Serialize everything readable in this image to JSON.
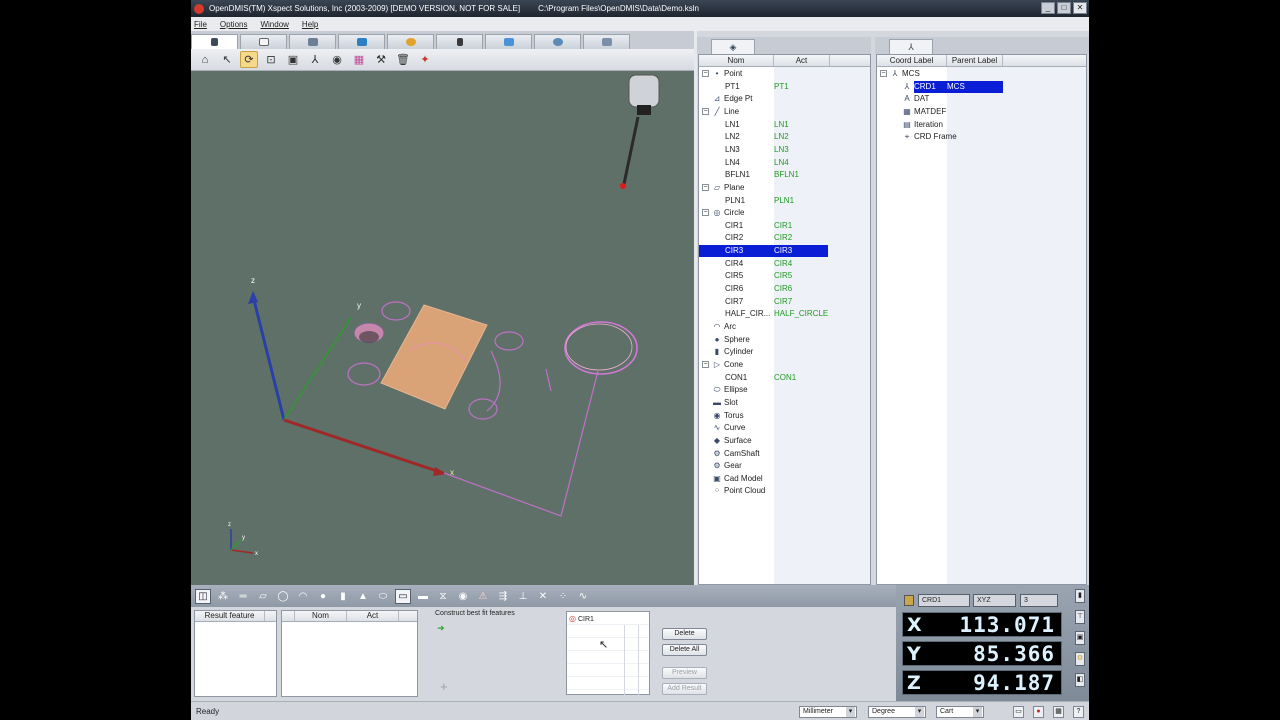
{
  "window": {
    "title": "OpenDMIS(TM) Xspect Solutions, Inc (2003-2009) [DEMO VERSION, NOT FOR SALE]",
    "path": "C:\\Program Files\\OpenDMIS\\Data\\Demo.ksln",
    "minimize": "_",
    "restore": "□",
    "close": "✕"
  },
  "menu": [
    "File",
    "Options",
    "Window",
    "Help"
  ],
  "feature_tree": {
    "headers": [
      "Nom",
      "Act"
    ],
    "rows": [
      {
        "nom": "Point",
        "act": "",
        "type": "group",
        "icon": "point-icon",
        "glyph": "•"
      },
      {
        "nom": "PT1",
        "act": "PT1",
        "type": "item"
      },
      {
        "nom": "Edge Pt",
        "act": "",
        "type": "leaf",
        "icon": "edge-point-icon",
        "glyph": "⊿"
      },
      {
        "nom": "Line",
        "act": "",
        "type": "group",
        "icon": "line-icon",
        "glyph": "╱"
      },
      {
        "nom": "LN1",
        "act": "LN1",
        "type": "item"
      },
      {
        "nom": "LN2",
        "act": "LN2",
        "type": "item"
      },
      {
        "nom": "LN3",
        "act": "LN3",
        "type": "item"
      },
      {
        "nom": "LN4",
        "act": "LN4",
        "type": "item"
      },
      {
        "nom": "BFLN1",
        "act": "BFLN1",
        "type": "item"
      },
      {
        "nom": "Plane",
        "act": "",
        "type": "group",
        "icon": "plane-icon",
        "glyph": "▱"
      },
      {
        "nom": "PLN1",
        "act": "PLN1",
        "type": "item"
      },
      {
        "nom": "Circle",
        "act": "",
        "type": "group",
        "icon": "circle-icon",
        "glyph": "◎"
      },
      {
        "nom": "CIR1",
        "act": "CIR1",
        "type": "item"
      },
      {
        "nom": "CIR2",
        "act": "CIR2",
        "type": "item"
      },
      {
        "nom": "CIR3",
        "act": "CIR3",
        "type": "item",
        "selected": true
      },
      {
        "nom": "CIR4",
        "act": "CIR4",
        "type": "item"
      },
      {
        "nom": "CIR5",
        "act": "CIR5",
        "type": "item"
      },
      {
        "nom": "CIR6",
        "act": "CIR6",
        "type": "item"
      },
      {
        "nom": "CIR7",
        "act": "CIR7",
        "type": "item"
      },
      {
        "nom": "HALF_CIR...",
        "act": "HALF_CIRCLE",
        "type": "item"
      },
      {
        "nom": "Arc",
        "act": "",
        "type": "leaf",
        "icon": "arc-icon",
        "glyph": "◠"
      },
      {
        "nom": "Sphere",
        "act": "",
        "type": "leaf",
        "icon": "sphere-icon",
        "glyph": "●"
      },
      {
        "nom": "Cylinder",
        "act": "",
        "type": "leaf",
        "icon": "cylinder-icon",
        "glyph": "▮"
      },
      {
        "nom": "Cone",
        "act": "",
        "type": "group",
        "icon": "cone-icon",
        "glyph": "▷"
      },
      {
        "nom": "CON1",
        "act": "CON1",
        "type": "item"
      },
      {
        "nom": "Ellipse",
        "act": "",
        "type": "leaf",
        "icon": "ellipse-icon",
        "glyph": "⬭"
      },
      {
        "nom": "Slot",
        "act": "",
        "type": "leaf",
        "icon": "slot-icon",
        "glyph": "▬"
      },
      {
        "nom": "Torus",
        "act": "",
        "type": "leaf",
        "icon": "torus-icon",
        "glyph": "◉"
      },
      {
        "nom": "Curve",
        "act": "",
        "type": "leaf",
        "icon": "curve-icon",
        "glyph": "∿"
      },
      {
        "nom": "Surface",
        "act": "",
        "type": "leaf",
        "icon": "surface-icon",
        "glyph": "◆"
      },
      {
        "nom": "CamShaft",
        "act": "",
        "type": "leaf",
        "icon": "camshaft-icon",
        "glyph": "⚙"
      },
      {
        "nom": "Gear",
        "act": "",
        "type": "leaf",
        "icon": "gear-icon",
        "glyph": "⚙"
      },
      {
        "nom": "Cad Model",
        "act": "",
        "type": "leaf",
        "icon": "cad-model-icon",
        "glyph": "▣"
      },
      {
        "nom": "Point Cloud",
        "act": "",
        "type": "leaf",
        "icon": "point-cloud-icon",
        "glyph": "⁘"
      }
    ]
  },
  "coord_tree": {
    "headers": [
      "Coord Label",
      "Parent Label"
    ],
    "rows": [
      {
        "label": "MCS",
        "parent": "",
        "type": "group",
        "icon": "axis-icon",
        "glyph": "⅄"
      },
      {
        "label": "CRD1",
        "parent": "MCS",
        "type": "item",
        "selected": true,
        "icon": "axis-icon",
        "glyph": "⅄"
      },
      {
        "label": "DAT",
        "parent": "",
        "type": "leaf",
        "icon": "datum-icon",
        "glyph": "A"
      },
      {
        "label": "MATDEF",
        "parent": "",
        "type": "leaf",
        "icon": "matdef-icon",
        "glyph": "▦"
      },
      {
        "label": "Iteration",
        "parent": "",
        "type": "leaf",
        "icon": "iteration-icon",
        "glyph": "▤"
      },
      {
        "label": "CRD Frame",
        "parent": "",
        "type": "leaf",
        "icon": "frame-icon",
        "glyph": "⌖"
      }
    ]
  },
  "bottom_panel": {
    "result_header": "Result feature",
    "list_headers": [
      "Nom",
      "Act"
    ],
    "construct_label": "Construct best fit features",
    "selected_feature": "CIR1",
    "delete": "Delete",
    "delete_all": "Delete All",
    "preview": "Preview",
    "add_result": "Add Result"
  },
  "dro": {
    "coord_system": "CRD1",
    "mode": "XYZ",
    "decimals": "3",
    "axes": [
      {
        "label": "X",
        "value": "113.071"
      },
      {
        "label": "Y",
        "value": "85.366"
      },
      {
        "label": "Z",
        "value": "94.187"
      }
    ]
  },
  "viewport": {
    "axis_x": "x",
    "axis_y": "y",
    "axis_z": "z"
  },
  "status": {
    "ready": "Ready",
    "units": "Millimeter",
    "angle": "Degree",
    "coord": "Cart"
  }
}
